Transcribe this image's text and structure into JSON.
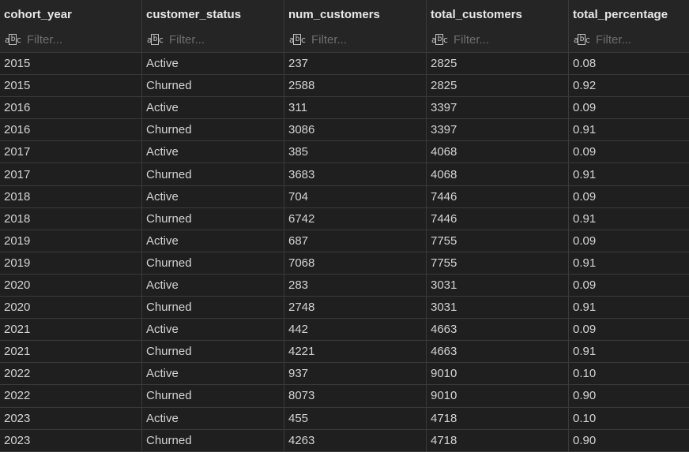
{
  "table": {
    "columns": [
      {
        "name": "cohort_year",
        "placeholder": "Filter..."
      },
      {
        "name": "customer_status",
        "placeholder": "Filter..."
      },
      {
        "name": "num_customers",
        "placeholder": "Filter..."
      },
      {
        "name": "total_customers",
        "placeholder": "Filter..."
      },
      {
        "name": "total_percentage",
        "placeholder": "Filter..."
      }
    ],
    "filter_icon": "abc-text-filter-icon",
    "rows": [
      [
        "2015",
        "Active",
        "237",
        "2825",
        "0.08"
      ],
      [
        "2015",
        "Churned",
        "2588",
        "2825",
        "0.92"
      ],
      [
        "2016",
        "Active",
        "311",
        "3397",
        "0.09"
      ],
      [
        "2016",
        "Churned",
        "3086",
        "3397",
        "0.91"
      ],
      [
        "2017",
        "Active",
        "385",
        "4068",
        "0.09"
      ],
      [
        "2017",
        "Churned",
        "3683",
        "4068",
        "0.91"
      ],
      [
        "2018",
        "Active",
        "704",
        "7446",
        "0.09"
      ],
      [
        "2018",
        "Churned",
        "6742",
        "7446",
        "0.91"
      ],
      [
        "2019",
        "Active",
        "687",
        "7755",
        "0.09"
      ],
      [
        "2019",
        "Churned",
        "7068",
        "7755",
        "0.91"
      ],
      [
        "2020",
        "Active",
        "283",
        "3031",
        "0.09"
      ],
      [
        "2020",
        "Churned",
        "2748",
        "3031",
        "0.91"
      ],
      [
        "2021",
        "Active",
        "442",
        "4663",
        "0.09"
      ],
      [
        "2021",
        "Churned",
        "4221",
        "4663",
        "0.91"
      ],
      [
        "2022",
        "Active",
        "937",
        "9010",
        "0.10"
      ],
      [
        "2022",
        "Churned",
        "8073",
        "9010",
        "0.90"
      ],
      [
        "2023",
        "Active",
        "455",
        "4718",
        "0.10"
      ],
      [
        "2023",
        "Churned",
        "4263",
        "4718",
        "0.90"
      ]
    ]
  }
}
